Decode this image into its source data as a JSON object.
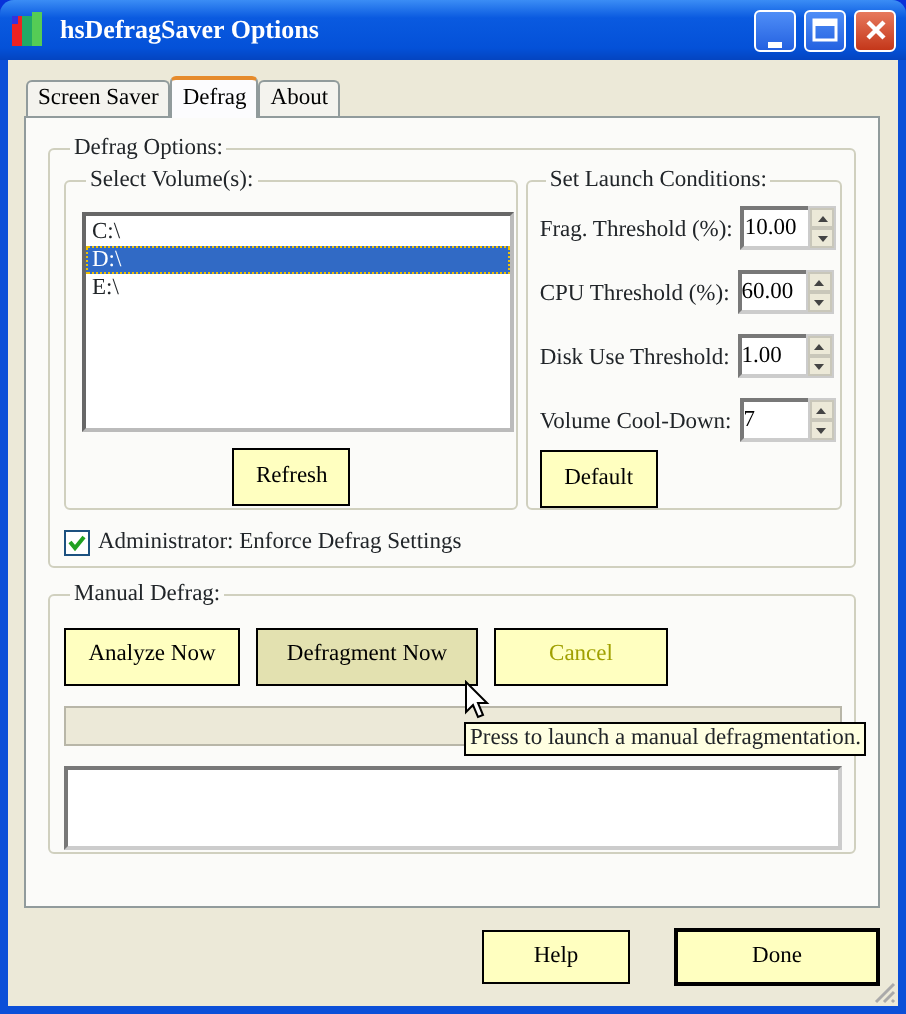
{
  "window": {
    "title": "hsDefragSaver Options"
  },
  "tabs": [
    {
      "label": "Screen Saver",
      "selected": false
    },
    {
      "label": "Defrag",
      "selected": true
    },
    {
      "label": "About",
      "selected": false
    }
  ],
  "defrag_options": {
    "title": "Defrag Options:",
    "volumes": {
      "title": "Select Volume(s):",
      "items": [
        {
          "label": "C:\\",
          "selected": false
        },
        {
          "label": "D:\\",
          "selected": true
        },
        {
          "label": "E:\\",
          "selected": false
        }
      ],
      "refresh_button": "Refresh"
    },
    "launch_conditions": {
      "title": "Set Launch Conditions:",
      "fields": [
        {
          "label": "Frag. Threshold (%):",
          "value": "10.00"
        },
        {
          "label": "CPU Threshold (%):",
          "value": "60.00"
        },
        {
          "label": "Disk Use Threshold:",
          "value": "1.00"
        },
        {
          "label": "Volume Cool-Down:",
          "value": "7"
        }
      ],
      "default_button": "Default"
    },
    "enforce": {
      "label": "Administrator: Enforce Defrag Settings",
      "checked": true
    }
  },
  "manual_defrag": {
    "title": "Manual Defrag:",
    "buttons": [
      {
        "label": "Analyze Now",
        "hovered": false,
        "disabled": false
      },
      {
        "label": "Defragment Now",
        "hovered": true,
        "disabled": false
      },
      {
        "label": "Cancel",
        "hovered": false,
        "disabled": true
      }
    ],
    "progress": {
      "level": 0
    }
  },
  "tooltip": {
    "text": "Press to launch a manual defragmentation."
  },
  "footer_buttons": [
    {
      "label": "Help",
      "default": false
    },
    {
      "label": "Done",
      "default": true
    }
  ]
}
